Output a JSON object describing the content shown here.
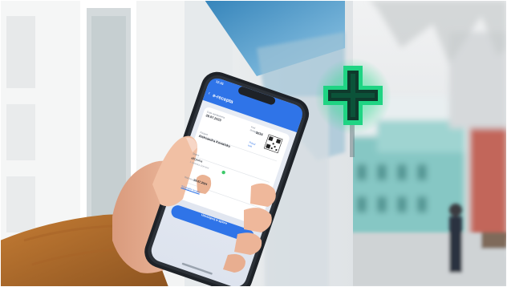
{
  "status_bar": {
    "time": "12:41"
  },
  "app": {
    "back_icon": "chevron-left-icon",
    "title": "e-recepta"
  },
  "prescription": {
    "issue_date_label": "Data wystawienia",
    "issue_date": "28.07.2023",
    "access_code_label": "Kod dostępu",
    "access_code": "3234",
    "qr_icon": "qr-code-icon",
    "show_code_label": "Pokaż kod",
    "patient_label": "Pacjent",
    "patient_name": "Aleksandra Kowalska",
    "status_label": "Status",
    "status": "aktywna",
    "status_color": "#3ec96a",
    "dosage_label": "Dawkowanie",
    "dosage_value": "1 tabletka dziennie",
    "valid_until_label": "Ważna do",
    "valid_until": "28.07.2024",
    "details_link": "Szczegóły recepty",
    "primary_button": "Udostępnij w aptece"
  },
  "colors": {
    "app_blue": "#2f74e8",
    "sign_green": "#27d98a"
  }
}
